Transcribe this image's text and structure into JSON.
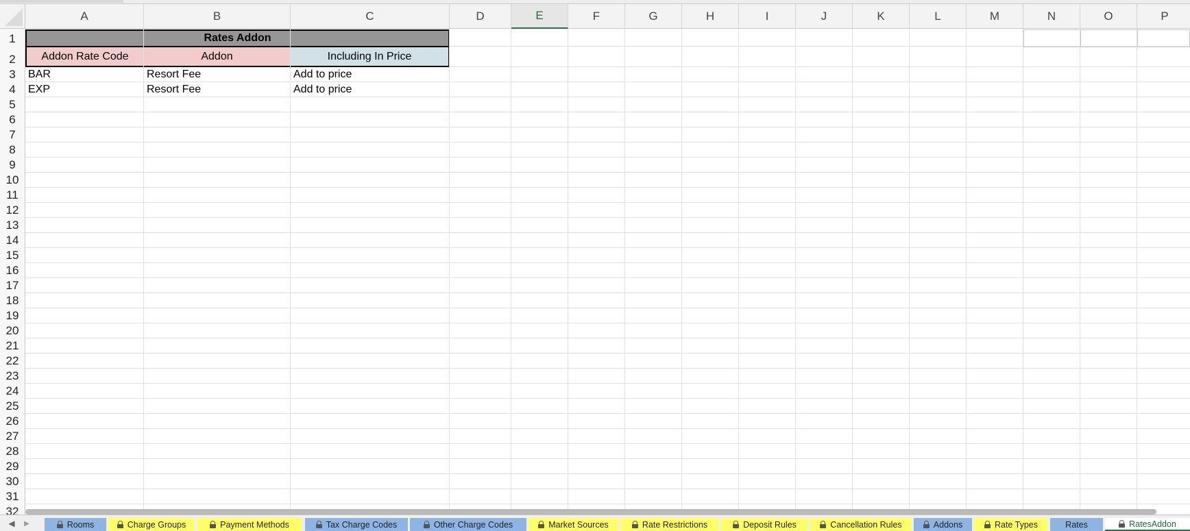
{
  "columns": [
    "A",
    "B",
    "C",
    "D",
    "E",
    "F",
    "G",
    "H",
    "I",
    "J",
    "K",
    "L",
    "M",
    "N",
    "O",
    "P"
  ],
  "selected_column": "E",
  "rows": [
    "1",
    "2",
    "3",
    "4",
    "5",
    "6",
    "7",
    "8",
    "9",
    "10",
    "11",
    "12",
    "13",
    "14",
    "15",
    "16",
    "17",
    "18",
    "19",
    "20",
    "21",
    "22",
    "23",
    "24",
    "25",
    "26",
    "27",
    "28",
    "29",
    "30",
    "31",
    "32"
  ],
  "sheet": {
    "title": "Rates Addon",
    "headers": [
      "Addon Rate Code",
      "Addon",
      "Including In Price"
    ],
    "header_colors": [
      "#f2cccc",
      "#f2cccc",
      "#d2e1e6"
    ],
    "data": [
      [
        "BAR",
        "Resort Fee",
        "Add to price"
      ],
      [
        "EXP",
        "Resort Fee",
        "Add to price"
      ]
    ]
  },
  "tabs": [
    {
      "label": "Rooms",
      "color": "#8eb4e3",
      "locked": true
    },
    {
      "label": "Charge Groups",
      "color": "#ffff66",
      "locked": true
    },
    {
      "label": "Payment Methods",
      "color": "#ffff66",
      "locked": true
    },
    {
      "label": "Tax Charge Codes",
      "color": "#8eb4e3",
      "locked": true
    },
    {
      "label": "Other Charge Codes",
      "color": "#8eb4e3",
      "locked": true
    },
    {
      "label": "Market Sources",
      "color": "#ffff66",
      "locked": true
    },
    {
      "label": "Rate Restrictions",
      "color": "#ffff66",
      "locked": true
    },
    {
      "label": "Deposit Rules",
      "color": "#ffff66",
      "locked": true
    },
    {
      "label": "Cancellation Rules",
      "color": "#ffff66",
      "locked": true
    },
    {
      "label": "Addons",
      "color": "#8eb4e3",
      "locked": true
    },
    {
      "label": "Rate Types",
      "color": "#ffff66",
      "locked": true
    },
    {
      "label": "Rates",
      "color": "#8eb4e3",
      "locked": false
    },
    {
      "label": "RatesAddon",
      "color": "#ffffff",
      "locked": true,
      "active": true
    }
  ],
  "nav": {
    "prev": "◀",
    "next": "▶"
  }
}
